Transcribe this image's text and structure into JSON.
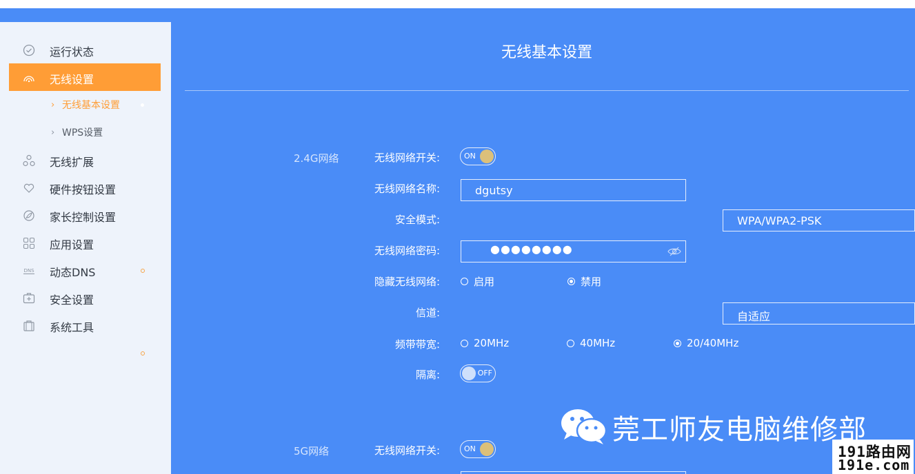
{
  "sidebar": {
    "items": [
      {
        "label": "运行状态",
        "icon": "check-circle-icon"
      },
      {
        "label": "无线设置",
        "icon": "wifi-icon",
        "active": true
      },
      {
        "label": "无线扩展",
        "icon": "network-icon"
      },
      {
        "label": "硬件按钮设置",
        "icon": "heart-icon"
      },
      {
        "label": "家长控制设置",
        "icon": "leaf-icon"
      },
      {
        "label": "应用设置",
        "icon": "apps-grid-icon"
      },
      {
        "label": "动态DNS",
        "icon": "dns-icon"
      },
      {
        "label": "安全设置",
        "icon": "first-aid-kit-icon"
      },
      {
        "label": "系统工具",
        "icon": "toolbox-icon"
      }
    ],
    "sub_items": [
      {
        "label": "无线基本设置",
        "active": true
      },
      {
        "label": "WPS设置"
      }
    ],
    "dns_icon_text": "DNS"
  },
  "main": {
    "title": "无线基本设置",
    "band24": {
      "section_label": "2.4G网络",
      "switch_label": "无线网络开关:",
      "switch_state": "ON",
      "ssid_label": "无线网络名称:",
      "ssid_value": "dgutsy",
      "security_label": "安全模式:",
      "security_value": "WPA/WPA2-PSK",
      "password_label": "无线网络密码:",
      "password_mask": "●●●●●●●●",
      "hide_label": "隐藏无线网络:",
      "hide_options": [
        {
          "label": "启用",
          "selected": false
        },
        {
          "label": "禁用",
          "selected": true
        }
      ],
      "channel_label": "信道:",
      "channel_value": "自适应",
      "bandwidth_label": "频带带宽:",
      "bandwidth_options": [
        {
          "label": "20MHz",
          "selected": false
        },
        {
          "label": "40MHz",
          "selected": false
        },
        {
          "label": "20/40MHz",
          "selected": true
        }
      ],
      "isolation_label": "隔离:",
      "isolation_state": "OFF"
    },
    "band5": {
      "section_label": "5G网络",
      "switch_label": "无线网络开关:",
      "switch_state": "ON"
    }
  },
  "watermarks": {
    "wechat_text": "莞工师友电脑维修部",
    "wechat_icon": "wechat-icon",
    "site_line1": "191路由网",
    "site_line2": "191e.com"
  },
  "colors": {
    "accent_orange": "#ff9d36",
    "panel_blue": "#4a8cf7",
    "sidebar_bg": "#eef3fb",
    "toggle_on_knob": "#dcc07a"
  }
}
